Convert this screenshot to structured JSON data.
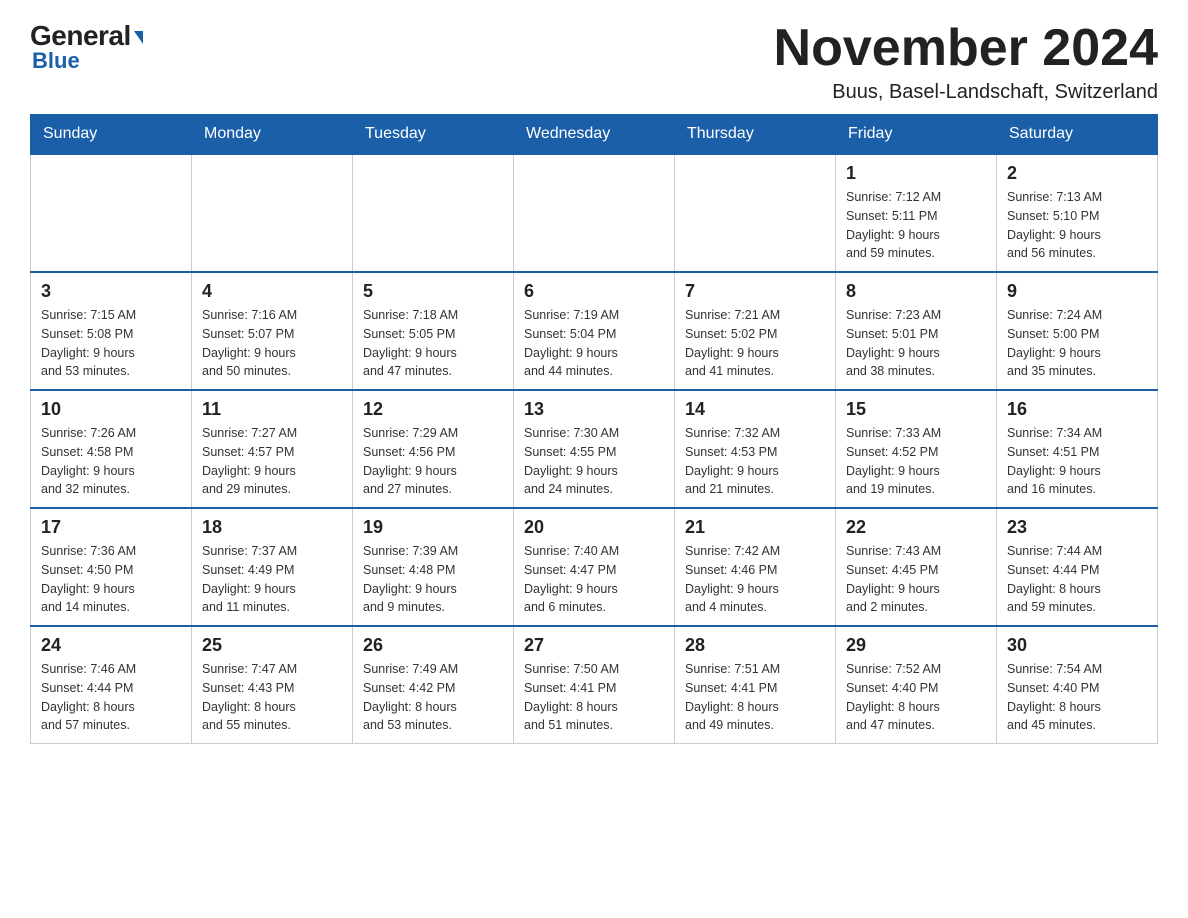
{
  "logo": {
    "top": "General",
    "triangle": "▶",
    "bottom": "Blue"
  },
  "title": "November 2024",
  "location": "Buus, Basel-Landschaft, Switzerland",
  "days_of_week": [
    "Sunday",
    "Monday",
    "Tuesday",
    "Wednesday",
    "Thursday",
    "Friday",
    "Saturday"
  ],
  "weeks": [
    [
      {
        "day": "",
        "info": ""
      },
      {
        "day": "",
        "info": ""
      },
      {
        "day": "",
        "info": ""
      },
      {
        "day": "",
        "info": ""
      },
      {
        "day": "",
        "info": ""
      },
      {
        "day": "1",
        "info": "Sunrise: 7:12 AM\nSunset: 5:11 PM\nDaylight: 9 hours\nand 59 minutes."
      },
      {
        "day": "2",
        "info": "Sunrise: 7:13 AM\nSunset: 5:10 PM\nDaylight: 9 hours\nand 56 minutes."
      }
    ],
    [
      {
        "day": "3",
        "info": "Sunrise: 7:15 AM\nSunset: 5:08 PM\nDaylight: 9 hours\nand 53 minutes."
      },
      {
        "day": "4",
        "info": "Sunrise: 7:16 AM\nSunset: 5:07 PM\nDaylight: 9 hours\nand 50 minutes."
      },
      {
        "day": "5",
        "info": "Sunrise: 7:18 AM\nSunset: 5:05 PM\nDaylight: 9 hours\nand 47 minutes."
      },
      {
        "day": "6",
        "info": "Sunrise: 7:19 AM\nSunset: 5:04 PM\nDaylight: 9 hours\nand 44 minutes."
      },
      {
        "day": "7",
        "info": "Sunrise: 7:21 AM\nSunset: 5:02 PM\nDaylight: 9 hours\nand 41 minutes."
      },
      {
        "day": "8",
        "info": "Sunrise: 7:23 AM\nSunset: 5:01 PM\nDaylight: 9 hours\nand 38 minutes."
      },
      {
        "day": "9",
        "info": "Sunrise: 7:24 AM\nSunset: 5:00 PM\nDaylight: 9 hours\nand 35 minutes."
      }
    ],
    [
      {
        "day": "10",
        "info": "Sunrise: 7:26 AM\nSunset: 4:58 PM\nDaylight: 9 hours\nand 32 minutes."
      },
      {
        "day": "11",
        "info": "Sunrise: 7:27 AM\nSunset: 4:57 PM\nDaylight: 9 hours\nand 29 minutes."
      },
      {
        "day": "12",
        "info": "Sunrise: 7:29 AM\nSunset: 4:56 PM\nDaylight: 9 hours\nand 27 minutes."
      },
      {
        "day": "13",
        "info": "Sunrise: 7:30 AM\nSunset: 4:55 PM\nDaylight: 9 hours\nand 24 minutes."
      },
      {
        "day": "14",
        "info": "Sunrise: 7:32 AM\nSunset: 4:53 PM\nDaylight: 9 hours\nand 21 minutes."
      },
      {
        "day": "15",
        "info": "Sunrise: 7:33 AM\nSunset: 4:52 PM\nDaylight: 9 hours\nand 19 minutes."
      },
      {
        "day": "16",
        "info": "Sunrise: 7:34 AM\nSunset: 4:51 PM\nDaylight: 9 hours\nand 16 minutes."
      }
    ],
    [
      {
        "day": "17",
        "info": "Sunrise: 7:36 AM\nSunset: 4:50 PM\nDaylight: 9 hours\nand 14 minutes."
      },
      {
        "day": "18",
        "info": "Sunrise: 7:37 AM\nSunset: 4:49 PM\nDaylight: 9 hours\nand 11 minutes."
      },
      {
        "day": "19",
        "info": "Sunrise: 7:39 AM\nSunset: 4:48 PM\nDaylight: 9 hours\nand 9 minutes."
      },
      {
        "day": "20",
        "info": "Sunrise: 7:40 AM\nSunset: 4:47 PM\nDaylight: 9 hours\nand 6 minutes."
      },
      {
        "day": "21",
        "info": "Sunrise: 7:42 AM\nSunset: 4:46 PM\nDaylight: 9 hours\nand 4 minutes."
      },
      {
        "day": "22",
        "info": "Sunrise: 7:43 AM\nSunset: 4:45 PM\nDaylight: 9 hours\nand 2 minutes."
      },
      {
        "day": "23",
        "info": "Sunrise: 7:44 AM\nSunset: 4:44 PM\nDaylight: 8 hours\nand 59 minutes."
      }
    ],
    [
      {
        "day": "24",
        "info": "Sunrise: 7:46 AM\nSunset: 4:44 PM\nDaylight: 8 hours\nand 57 minutes."
      },
      {
        "day": "25",
        "info": "Sunrise: 7:47 AM\nSunset: 4:43 PM\nDaylight: 8 hours\nand 55 minutes."
      },
      {
        "day": "26",
        "info": "Sunrise: 7:49 AM\nSunset: 4:42 PM\nDaylight: 8 hours\nand 53 minutes."
      },
      {
        "day": "27",
        "info": "Sunrise: 7:50 AM\nSunset: 4:41 PM\nDaylight: 8 hours\nand 51 minutes."
      },
      {
        "day": "28",
        "info": "Sunrise: 7:51 AM\nSunset: 4:41 PM\nDaylight: 8 hours\nand 49 minutes."
      },
      {
        "day": "29",
        "info": "Sunrise: 7:52 AM\nSunset: 4:40 PM\nDaylight: 8 hours\nand 47 minutes."
      },
      {
        "day": "30",
        "info": "Sunrise: 7:54 AM\nSunset: 4:40 PM\nDaylight: 8 hours\nand 45 minutes."
      }
    ]
  ]
}
